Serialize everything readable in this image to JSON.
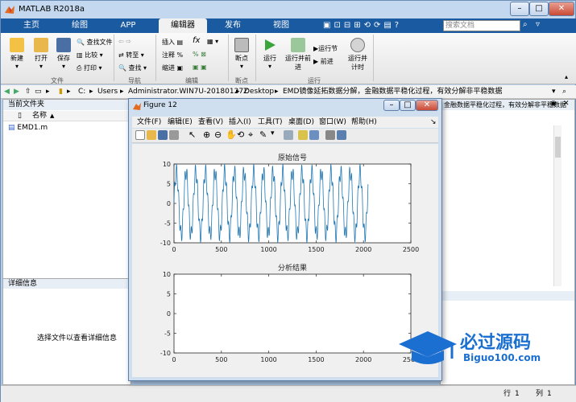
{
  "window": {
    "title": "MATLAB R2018a"
  },
  "tabs": [
    "主页",
    "绘图",
    "APP",
    "编辑器",
    "发布",
    "视图"
  ],
  "search": {
    "placeholder": "搜索文档"
  },
  "ribbon": {
    "file_group": {
      "label": "文件",
      "new": "新建",
      "open": "打开",
      "save": "保存",
      "find_files": "查找文件",
      "compare": "比较",
      "print": "打印"
    },
    "nav_group": {
      "label": "导航",
      "goto": "转至",
      "find": "查找"
    },
    "edit_group": {
      "label": "编辑",
      "insert": "插入",
      "comment": "注释",
      "indent": "缩进",
      "fx": "fx"
    },
    "breakpoints_group": {
      "label": "断点",
      "breakpoints": "断点"
    },
    "run_group": {
      "label": "运行",
      "run": "运行",
      "run_advance": "运行并前进",
      "run_section": "运行节",
      "advance": "前进",
      "run_time": "运行并计时"
    }
  },
  "address": {
    "parts": [
      "C:",
      "Users",
      "Administrator.WIN7U-20180127Z",
      "Desktop",
      "EMD镜像延拓数据分解，金融数据平稳化过程，有效分解非平稳数据"
    ]
  },
  "left_panel": {
    "title": "当前文件夹",
    "col_name": "名称",
    "sort_arrow": "▲",
    "file": "EMD1.m"
  },
  "detail_panel": {
    "title": "详细信息",
    "hint": "选择文件以查看详细信息"
  },
  "right_panel": {
    "path_repeat": "金融数据平稳化过程，有效分解非平稳数据"
  },
  "status": {
    "row_label": "行",
    "row_value": "1",
    "col_label": "列",
    "col_value": "1"
  },
  "figure": {
    "title": "Figure 12",
    "menu": [
      "文件(F)",
      "编辑(E)",
      "查看(V)",
      "插入(I)",
      "工具(T)",
      "桌面(D)",
      "窗口(W)",
      "帮助(H)"
    ]
  },
  "chart_data": [
    {
      "type": "line",
      "title": "原始信号",
      "xlim": [
        0,
        2500
      ],
      "ylim": [
        -10,
        10
      ],
      "xticks": [
        "0",
        "500",
        "1000",
        "1500",
        "2000",
        "2500"
      ],
      "yticks": [
        "10",
        "5",
        "0",
        "-5",
        "-10"
      ],
      "series": [
        {
          "color": "#1f77b4",
          "x_range": [
            0,
            2048
          ],
          "periodic_components": [
            {
              "amplitude": 8,
              "period": 102
            },
            {
              "amplitude": 2,
              "period": 22
            }
          ]
        }
      ]
    },
    {
      "type": "line",
      "title": "分析结果",
      "xlim": [
        0,
        2500
      ],
      "ylim": [
        -10,
        10
      ],
      "xticks": [
        "0",
        "500",
        "1000",
        "1500",
        "2000",
        "2500"
      ],
      "yticks": [
        "10",
        "5",
        "0",
        "-5",
        "-10"
      ],
      "series": []
    }
  ],
  "watermark": {
    "cn": "必过源码",
    "url": "Biguo100.com"
  }
}
